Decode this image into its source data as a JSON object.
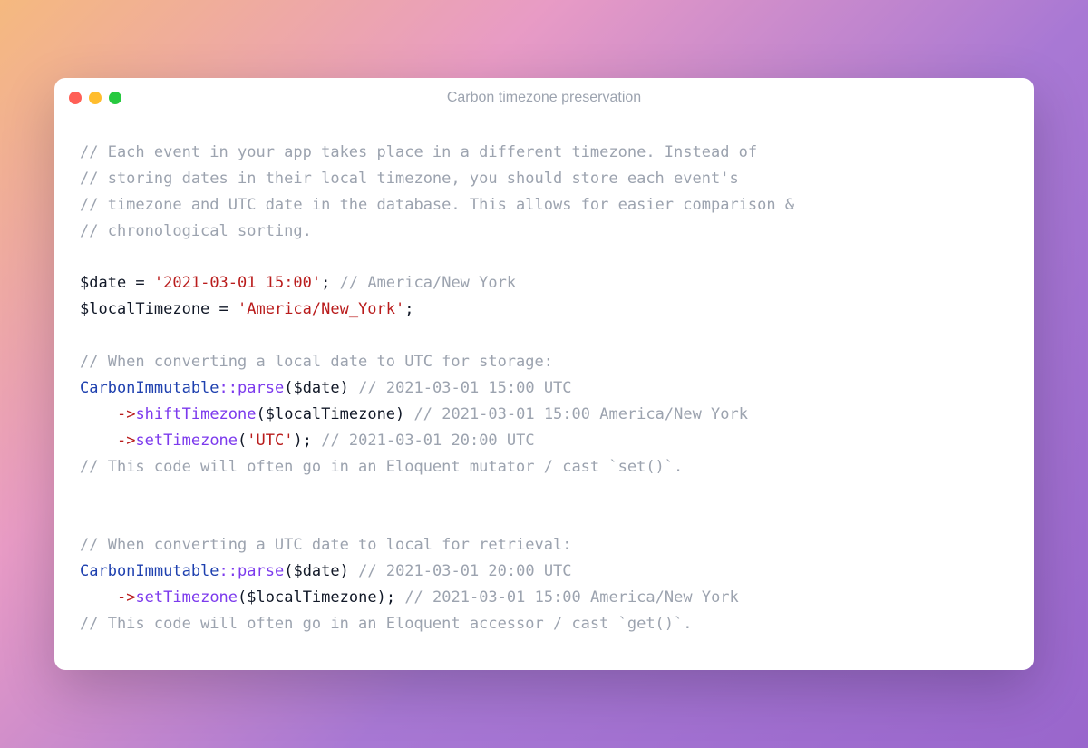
{
  "window": {
    "title": "Carbon timezone preservation",
    "traffic_lights": {
      "red": "#ff5f56",
      "yellow": "#ffbd2e",
      "green": "#27c93f"
    }
  },
  "code": {
    "c1a": "// Each event in your app takes place in a different timezone. Instead of",
    "c1b": "// storing dates in their local timezone, you should store each event's",
    "c1c": "// timezone and UTC date in the database. This allows for easier comparison &",
    "c1d": "// chronological sorting.",
    "var_date": "$date",
    "eq": " = ",
    "str_date": "'2021-03-01 15:00'",
    "semi": ";",
    "c_date_tz": " // America/New York",
    "var_localtz": "$localTimezone",
    "str_tz": "'America/New_York'",
    "c2": "// When converting a local date to UTC for storage:",
    "class": "CarbonImmutable",
    "scope": "::",
    "fn_parse": "parse",
    "lp": "(",
    "rp": ")",
    "c_parse1": " // 2021-03-01 15:00 UTC",
    "indent": "    ",
    "arrow": "->",
    "fn_shift": "shiftTimezone",
    "c_shift": " // 2021-03-01 15:00 America/New York",
    "fn_set": "setTimezone",
    "str_utc": "'UTC'",
    "c_setutc": " // 2021-03-01 20:00 UTC",
    "c3": "// This code will often go in an Eloquent mutator / cast `set()`.",
    "c4": "// When converting a UTC date to local for retrieval:",
    "c_parse2": " // 2021-03-01 20:00 UTC",
    "c_setlocal": " // 2021-03-01 15:00 America/New York",
    "c5": "// This code will often go in an Eloquent accessor / cast `get()`."
  }
}
